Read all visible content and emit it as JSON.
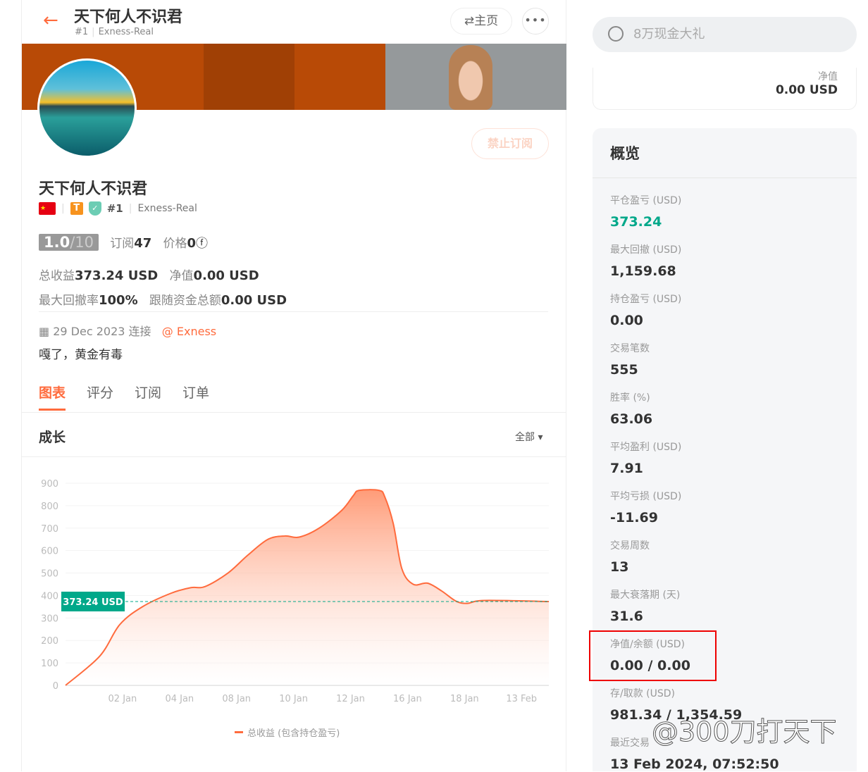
{
  "header": {
    "back": "←",
    "title": "天下何人不识君",
    "rank": "#1",
    "server": "Exness-Real",
    "home_btn": "⇄主页",
    "more_btn": "•••"
  },
  "profile": {
    "name": "天下何人不识君",
    "flag": "★",
    "tier": "T",
    "verified": "✓",
    "rank": "#1",
    "server": "Exness-Real",
    "block_btn": "禁止订阅",
    "score": "1.0",
    "score_max": "/10",
    "subs_label": "订阅",
    "subs": "47",
    "price_label": "价格",
    "price": "0",
    "price_icon": "ⓕ",
    "profit_label": "总收益",
    "profit": "373.24 USD",
    "equity_label": "净值",
    "equity": "0.00 USD",
    "dd_label": "最大回撤率",
    "dd": "100%",
    "follow_label": "跟随资金总额",
    "follow": "0.00 USD",
    "date_icon": "▦",
    "date": "29 Dec 2023 连接",
    "broker": "@ Exness",
    "bio": "嘎了，黄金有毒"
  },
  "tabs": [
    "图表",
    "评分",
    "订阅",
    "订单"
  ],
  "growth": {
    "title": "成长",
    "filter": "全部 ▾"
  },
  "chart_data": {
    "type": "area",
    "title": "成长",
    "y_ticks": [
      0,
      100,
      200,
      300,
      400,
      500,
      600,
      700,
      800,
      900
    ],
    "ylim": [
      0,
      900
    ],
    "x_ticks": [
      "02 Jan",
      "04 Jan",
      "08 Jan",
      "10 Jan",
      "12 Jan",
      "16 Jan",
      "18 Jan",
      "13 Feb"
    ],
    "series": [
      {
        "name": "总收益 (包含持仓盈亏)",
        "x": [
          0,
          0.6,
          0.95,
          1.35,
          1.85,
          2.2,
          2.45,
          2.85,
          3.2,
          3.55,
          3.85,
          4.1,
          4.45,
          4.85,
          5.05,
          5.15,
          5.5,
          5.6,
          5.75,
          5.9,
          6.1,
          6.35,
          6.6,
          6.85,
          7.05,
          7.35,
          8.48
        ],
        "values": [
          0,
          130,
          270,
          350,
          410,
          435,
          440,
          500,
          580,
          650,
          665,
          660,
          700,
          780,
          845,
          868,
          868,
          840,
          720,
          520,
          450,
          455,
          420,
          375,
          365,
          378,
          373.24
        ]
      }
    ],
    "current_label": "373.24 USD",
    "current": 373.24,
    "color": "#ff6b3d",
    "label_color": "#00a88a"
  },
  "sidebar": {
    "search_placeholder": "8万现金大礼",
    "equity_label": "净值",
    "equity": "0.00 USD",
    "overview_title": "概览",
    "stats": [
      {
        "label": "平仓盈亏 (USD)",
        "value": "373.24"
      },
      {
        "label": "最大回撤 (USD)",
        "value": "1,159.68"
      },
      {
        "label": "持仓盈亏 (USD)",
        "value": "0.00"
      },
      {
        "label": "交易笔数",
        "value": "555"
      },
      {
        "label": "胜率 (%)",
        "value": "63.06"
      },
      {
        "label": "平均盈利 (USD)",
        "value": "7.91"
      },
      {
        "label": "平均亏损 (USD)",
        "value": "-11.69"
      },
      {
        "label": "交易周数",
        "value": "13"
      },
      {
        "label": "最大衰落期 (天)",
        "value": "31.6"
      },
      {
        "label": "净值/余额 (USD)",
        "value": "0.00 / 0.00"
      },
      {
        "label": "存/取款 (USD)",
        "value": "981.34 / 1,354.59"
      },
      {
        "label": "最近交易",
        "value": "13 Feb 2024, 07:52:50"
      }
    ]
  },
  "watermark": "@300刀打天下"
}
